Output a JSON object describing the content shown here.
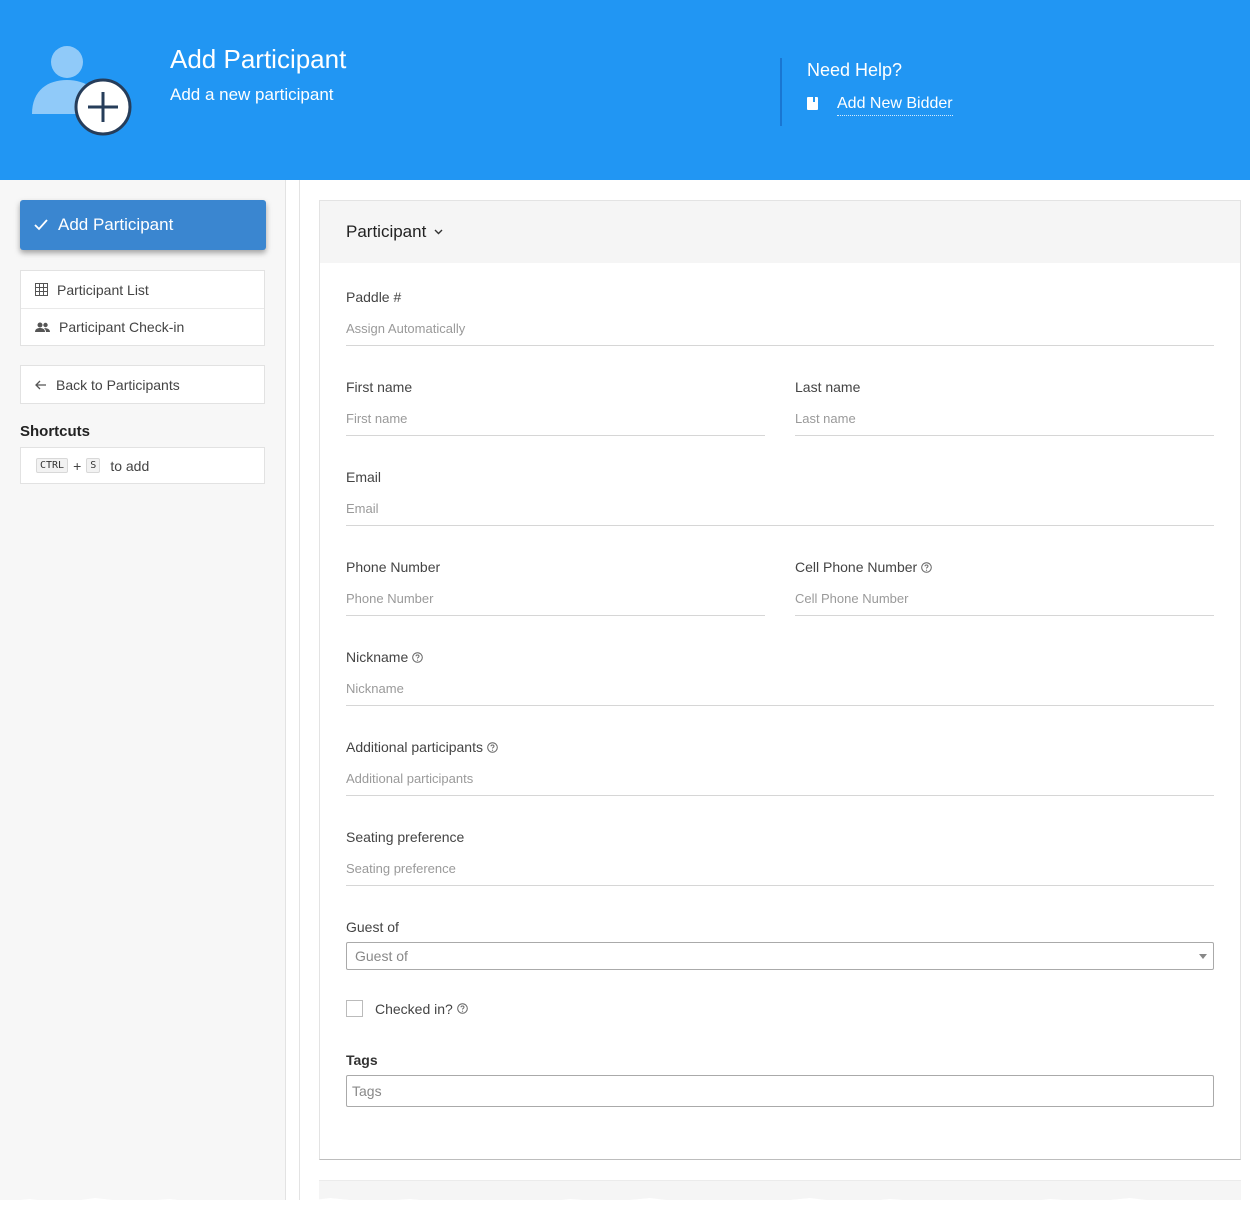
{
  "header": {
    "title": "Add Participant",
    "subtitle": "Add a new participant",
    "help_title": "Need Help?",
    "help_link": "Add New Bidder",
    "background_color": "#2196f3"
  },
  "sidebar": {
    "primary_button": "Add Participant",
    "nav_items": [
      {
        "label": "Participant List",
        "icon": "grid-icon"
      },
      {
        "label": "Participant Check-in",
        "icon": "people-icon"
      }
    ],
    "back_link": "Back to Participants",
    "shortcuts_label": "Shortcuts",
    "shortcut": {
      "key1": "CTRL",
      "plus": "+",
      "key2": "S",
      "action": "to add"
    }
  },
  "form": {
    "section_title": "Participant",
    "paddle": {
      "label": "Paddle #",
      "placeholder": "Assign Automatically"
    },
    "first_name": {
      "label": "First name",
      "placeholder": "First name"
    },
    "last_name": {
      "label": "Last name",
      "placeholder": "Last name"
    },
    "email": {
      "label": "Email",
      "placeholder": "Email"
    },
    "phone": {
      "label": "Phone Number",
      "placeholder": "Phone Number"
    },
    "cell_phone": {
      "label": "Cell Phone Number",
      "placeholder": "Cell Phone Number"
    },
    "nickname": {
      "label": "Nickname",
      "placeholder": "Nickname"
    },
    "additional": {
      "label": "Additional participants",
      "placeholder": "Additional participants"
    },
    "seating": {
      "label": "Seating preference",
      "placeholder": "Seating preference"
    },
    "guest_of": {
      "label": "Guest of",
      "placeholder": "Guest of"
    },
    "checked_in": {
      "label": "Checked in?",
      "checked": false
    },
    "tags": {
      "label": "Tags",
      "placeholder": "Tags"
    }
  }
}
